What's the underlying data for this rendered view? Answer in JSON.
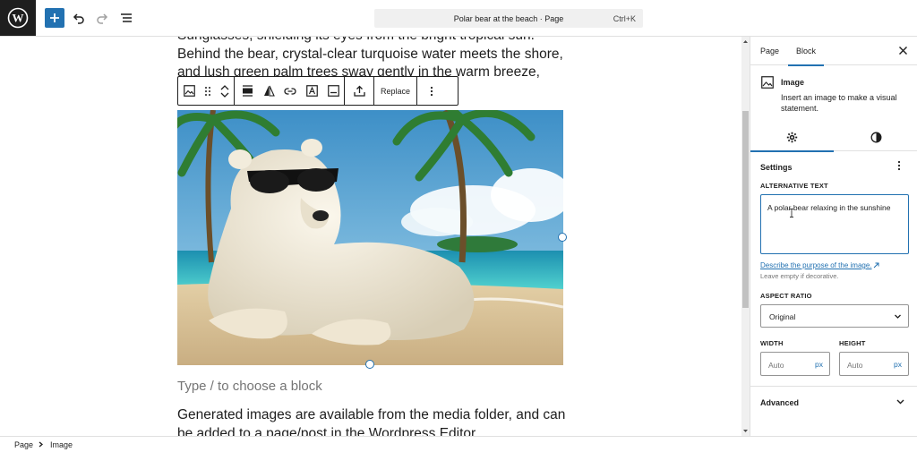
{
  "document": {
    "title": "Polar bear at the beach · Page",
    "shortcut": "Ctrl+K"
  },
  "editor": {
    "paragraph_top": "Sunglasses, shielding its eyes from the bright tropical sun. Behind the bear, crystal-clear turquoise water meets the shore, and lush green palm trees sway gently in the warm breeze, completing the",
    "placeholder": "Type / to choose a block",
    "paragraph_bottom": "Generated images are available from the media folder, and can be added to a page/post in the Wordpress Editor."
  },
  "block_toolbar": {
    "replace_label": "Replace"
  },
  "sidebar": {
    "tabs": [
      {
        "label": "Page"
      },
      {
        "label": "Block"
      }
    ],
    "active_tab": "Block",
    "block_card": {
      "title": "Image",
      "description": "Insert an image to make a visual statement."
    },
    "settings_title": "Settings",
    "alt_text": {
      "label": "ALTERNATIVE TEXT",
      "value": "A polar bear relaxing in the sunshine",
      "link": "Describe the purpose of the image.",
      "help": "Leave empty if decorative."
    },
    "aspect_ratio": {
      "label": "ASPECT RATIO",
      "selected": "Original"
    },
    "width": {
      "label": "WIDTH",
      "value": "Auto",
      "unit": "px"
    },
    "height": {
      "label": "HEIGHT",
      "value": "Auto",
      "unit": "px"
    },
    "advanced_label": "Advanced"
  },
  "breadcrumb": {
    "items": [
      {
        "label": "Page"
      },
      {
        "label": "Image"
      }
    ]
  },
  "colors": {
    "accent": "#2271b1",
    "dark": "#1e1e1e",
    "muted": "#757575"
  }
}
